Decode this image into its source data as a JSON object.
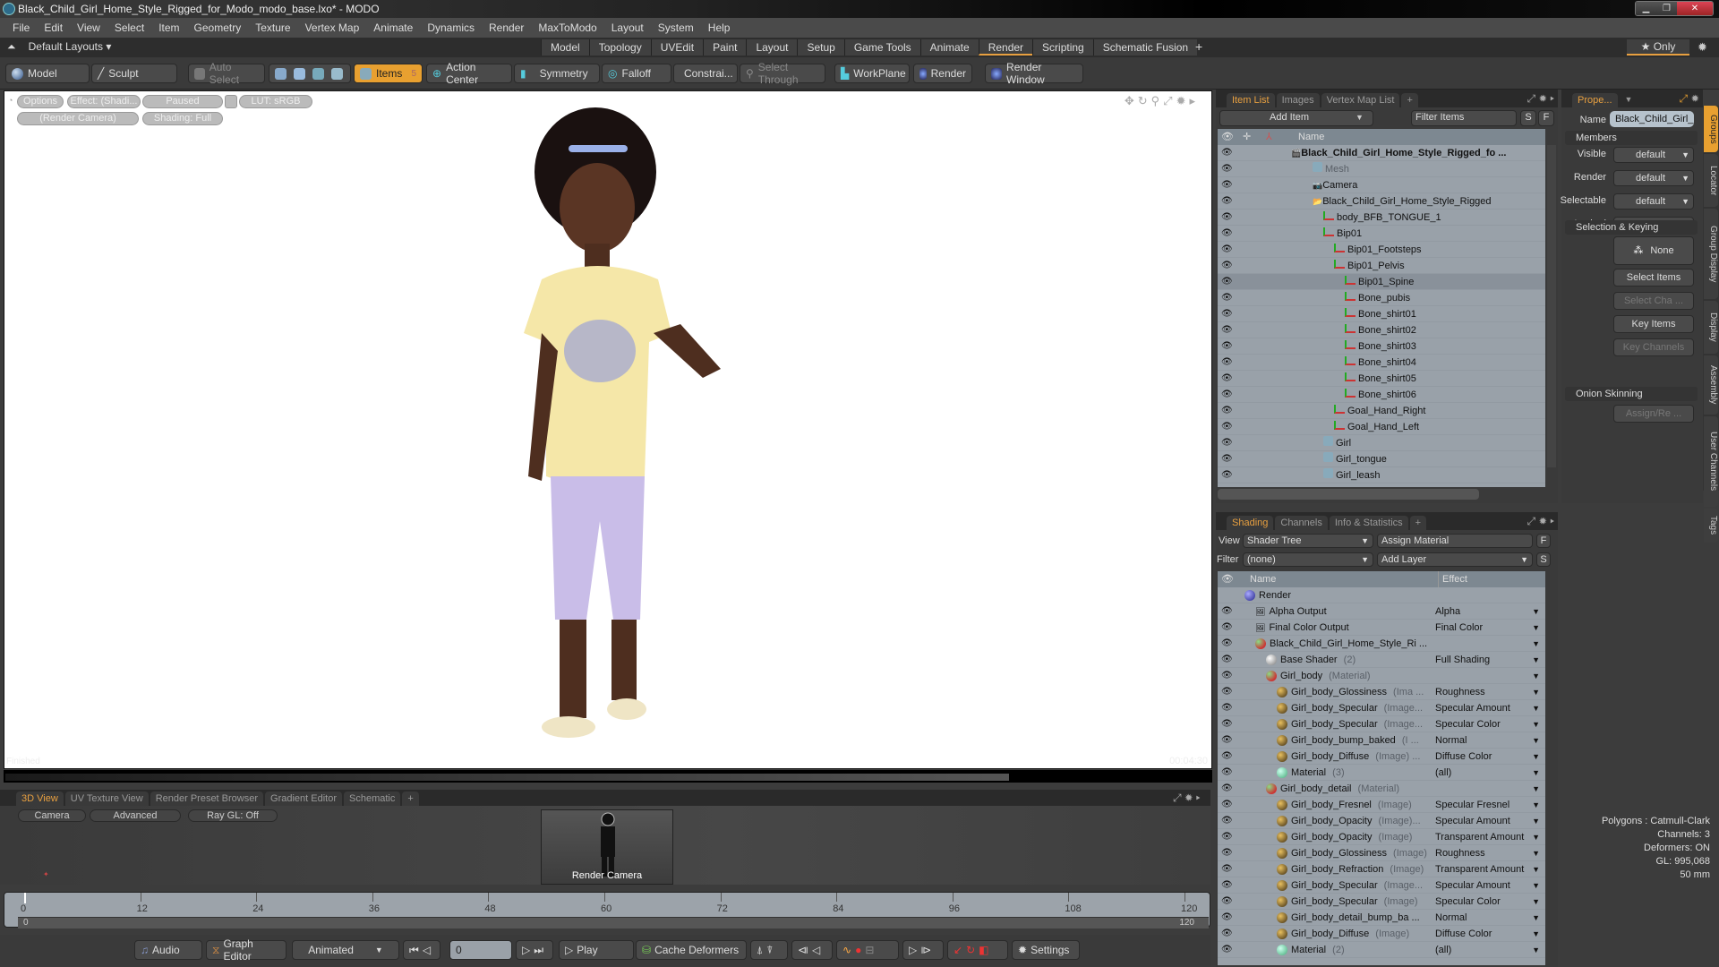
{
  "window": {
    "title": "Black_Child_Girl_Home_Style_Rigged_for_Modo_modo_base.lxo* - MODO",
    "buttons": [
      "minimize",
      "restore",
      "close"
    ]
  },
  "menu": [
    "File",
    "Edit",
    "View",
    "Select",
    "Item",
    "Geometry",
    "Texture",
    "Vertex Map",
    "Animate",
    "Dynamics",
    "Render",
    "MaxToModo",
    "Layout",
    "System",
    "Help"
  ],
  "layoutbar": {
    "default_layouts": "Default Layouts ▾",
    "tabs": [
      "Model",
      "Topology",
      "UVEdit",
      "Paint",
      "Layout",
      "Setup",
      "Game Tools",
      "Animate",
      "Render",
      "Scripting",
      "Schematic Fusion"
    ],
    "active_tab": "Render",
    "add": "+",
    "only": "★ Only"
  },
  "toolbar": {
    "model": "Model",
    "sculpt": "Sculpt",
    "auto_select": "Auto Select",
    "items": "Items",
    "items_count": "5",
    "action_center": "Action Center",
    "symmetry": "Symmetry",
    "falloff": "Falloff",
    "constraints": "Constrai...",
    "select_through": "Select Through",
    "workplane": "WorkPlane",
    "render": "Render",
    "render_window": "Render Window"
  },
  "viewport": {
    "pills": {
      "options": "Options",
      "effect": "Effect: (Shadi...",
      "paused": "Paused",
      "lut": "LUT: sRGB",
      "camera": "(Render Camera)",
      "shading": "Shading: Full"
    },
    "status_left": "Finished",
    "status_right": "00:04:30",
    "progress_fraction": 0.83
  },
  "bottom_tabs": [
    "3D View",
    "UV Texture View",
    "Render Preset Browser",
    "Gradient Editor",
    "Schematic"
  ],
  "view3d": {
    "camera": "Camera",
    "advanced": "Advanced",
    "raygl": "Ray GL: Off",
    "thumb_label": "Render Camera",
    "stats": [
      "Polygons : Catmull-Clark",
      "Channels: 3",
      "Deformers: ON",
      "GL: 995,068",
      "50 mm"
    ]
  },
  "timeline": {
    "ticks": [
      "0",
      "12",
      "24",
      "36",
      "48",
      "60",
      "72",
      "84",
      "96",
      "108",
      "120"
    ],
    "range_start": "0",
    "range_end": "120",
    "range_end2": "120"
  },
  "transport": {
    "audio": "Audio",
    "graph_editor": "Graph Editor",
    "animated": "Animated",
    "frame": "0",
    "play": "Play",
    "cache_deformers": "Cache Deformers",
    "settings": "Settings"
  },
  "item_list": {
    "tabs": [
      "Item List",
      "Images",
      "Vertex Map List"
    ],
    "add_item": "Add Item",
    "filter_placeholder": "Filter Items",
    "s": "S",
    "f": "F",
    "header": "Name",
    "rows": [
      {
        "name": "Black_Child_Girl_Home_Style_Rigged_fo ...",
        "indent": 0,
        "type": "scene",
        "bold": true
      },
      {
        "name": "Mesh",
        "indent": 2,
        "type": "mesh",
        "grey": true
      },
      {
        "name": "Camera",
        "indent": 2,
        "type": "camera"
      },
      {
        "name": "Black_Child_Girl_Home_Style_Rigged",
        "indent": 2,
        "type": "folder"
      },
      {
        "name": "body_BFB_TONGUE_1",
        "indent": 3,
        "type": "bone"
      },
      {
        "name": "Bip01",
        "indent": 3,
        "type": "bone"
      },
      {
        "name": "Bip01_Footsteps",
        "indent": 4,
        "type": "bone"
      },
      {
        "name": "Bip01_Pelvis",
        "indent": 4,
        "type": "bone"
      },
      {
        "name": "Bip01_Spine",
        "indent": 5,
        "type": "bone",
        "selected": true
      },
      {
        "name": "Bone_pubis",
        "indent": 5,
        "type": "bone"
      },
      {
        "name": "Bone_shirt01",
        "indent": 5,
        "type": "bone"
      },
      {
        "name": "Bone_shirt02",
        "indent": 5,
        "type": "bone"
      },
      {
        "name": "Bone_shirt03",
        "indent": 5,
        "type": "bone"
      },
      {
        "name": "Bone_shirt04",
        "indent": 5,
        "type": "bone"
      },
      {
        "name": "Bone_shirt05",
        "indent": 5,
        "type": "bone"
      },
      {
        "name": "Bone_shirt06",
        "indent": 5,
        "type": "bone"
      },
      {
        "name": "Goal_Hand_Right",
        "indent": 4,
        "type": "bone"
      },
      {
        "name": "Goal_Hand_Left",
        "indent": 4,
        "type": "bone"
      },
      {
        "name": "Girl",
        "indent": 3,
        "type": "mesh"
      },
      {
        "name": "Girl_tongue",
        "indent": 3,
        "type": "mesh"
      },
      {
        "name": "Girl_leash",
        "indent": 3,
        "type": "mesh"
      }
    ]
  },
  "properties": {
    "tab": "Prope...",
    "name_label": "Name",
    "name_value": "Black_Child_Girl_",
    "members": "Members",
    "fields": [
      {
        "label": "Visible",
        "value": "default"
      },
      {
        "label": "Render",
        "value": "default"
      },
      {
        "label": "Selectable",
        "value": "default"
      },
      {
        "label": "Locked",
        "value": "default"
      }
    ],
    "selection_keying": "Selection & Keying",
    "none": "None",
    "select_items": "Select Items",
    "select_channels": "Select Cha ...",
    "key_items": "Key Items",
    "key_channels": "Key Channels",
    "onion": "Onion Skinning",
    "assign": "Assign/Re ...",
    "side_tabs": [
      "Groups",
      "Locator",
      "Group Display",
      "Display",
      "Assembly",
      "User Channels",
      "Tags"
    ]
  },
  "shading": {
    "tabs": [
      "Shading",
      "Channels",
      "Info & Statistics"
    ],
    "view_label": "View",
    "view_value": "Shader Tree",
    "assign_material": "Assign Material",
    "filter_label": "Filter",
    "filter_value": "(none)",
    "add_layer": "Add Layer",
    "f": "F",
    "s": "S",
    "col_name": "Name",
    "col_effect": "Effect",
    "rows": [
      {
        "name": "Render",
        "sub": "",
        "effect": "",
        "indent": 0,
        "icon": "blue",
        "noeye": true
      },
      {
        "name": "Alpha Output",
        "sub": "",
        "effect": "Alpha",
        "indent": 1,
        "icon": "output"
      },
      {
        "name": "Final Color Output",
        "sub": "",
        "effect": "Final Color",
        "indent": 1,
        "icon": "output"
      },
      {
        "name": "Black_Child_Girl_Home_Style_Ri ...",
        "sub": "",
        "effect": "",
        "indent": 1,
        "icon": "mat"
      },
      {
        "name": "Base Shader",
        "sub": "(2)",
        "effect": "Full Shading",
        "indent": 2,
        "icon": "white"
      },
      {
        "name": "Girl_body",
        "sub": "(Material)",
        "effect": "",
        "indent": 2,
        "icon": "mat"
      },
      {
        "name": "Girl_body_Glossiness",
        "sub": "(Ima ...",
        "effect": "Roughness",
        "indent": 3,
        "icon": "gold"
      },
      {
        "name": "Girl_body_Specular",
        "sub": "(Image...",
        "effect": "Specular Amount",
        "indent": 3,
        "icon": "gold"
      },
      {
        "name": "Girl_body_Specular",
        "sub": "(Image...",
        "effect": "Specular Color",
        "indent": 3,
        "icon": "gold"
      },
      {
        "name": "Girl_body_bump_baked",
        "sub": "(I ...",
        "effect": "Normal",
        "indent": 3,
        "icon": "gold"
      },
      {
        "name": "Girl_body_Diffuse",
        "sub": "(Image) ...",
        "effect": "Diffuse Color",
        "indent": 3,
        "icon": "gold"
      },
      {
        "name": "Material",
        "sub": "(3)",
        "effect": "(all)",
        "indent": 3,
        "icon": "green"
      },
      {
        "name": "Girl_body_detail",
        "sub": "(Material)",
        "effect": "",
        "indent": 2,
        "icon": "mat"
      },
      {
        "name": "Girl_body_Fresnel",
        "sub": "(Image)",
        "effect": "Specular Fresnel",
        "indent": 3,
        "icon": "gold"
      },
      {
        "name": "Girl_body_Opacity",
        "sub": "(Image)...",
        "effect": "Specular Amount",
        "indent": 3,
        "icon": "gold"
      },
      {
        "name": "Girl_body_Opacity",
        "sub": "(Image)",
        "effect": "Transparent Amount",
        "indent": 3,
        "icon": "gold"
      },
      {
        "name": "Girl_body_Glossiness",
        "sub": "(Image)",
        "effect": "Roughness",
        "indent": 3,
        "icon": "gold"
      },
      {
        "name": "Girl_body_Refraction",
        "sub": "(Image)",
        "effect": "Transparent Amount",
        "indent": 3,
        "icon": "gold"
      },
      {
        "name": "Girl_body_Specular",
        "sub": "(Image...",
        "effect": "Specular Amount",
        "indent": 3,
        "icon": "gold"
      },
      {
        "name": "Girl_body_Specular",
        "sub": "(Image)",
        "effect": "Specular Color",
        "indent": 3,
        "icon": "gold"
      },
      {
        "name": "Girl_body_detail_bump_ba ...",
        "sub": "",
        "effect": "Normal",
        "indent": 3,
        "icon": "gold"
      },
      {
        "name": "Girl_body_Diffuse",
        "sub": "(Image)",
        "effect": "Diffuse Color",
        "indent": 3,
        "icon": "gold"
      },
      {
        "name": "Material",
        "sub": "(2)",
        "effect": "(all)",
        "indent": 3,
        "icon": "green"
      }
    ]
  },
  "colors": {
    "accent": "#e8a030",
    "list_bg": "#99a1a9",
    "panel": "#3a3a3a"
  }
}
